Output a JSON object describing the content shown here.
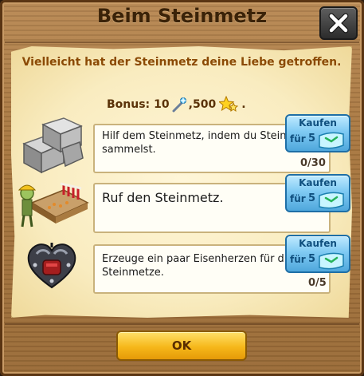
{
  "dialog": {
    "title": "Beim Steinmetz",
    "intro": "Vielleicht hat der Steinmetz deine Liebe getroffen."
  },
  "bonus": {
    "label": "Bonus:",
    "wand_amount": "10",
    "separator": ",",
    "stars_amount": "500",
    "end": ".",
    "icons": [
      "magic-wand-icon",
      "gold-stars-icon"
    ]
  },
  "tasks": [
    {
      "text": "Hilf dem Steinmetz, indem du Steine sammelst.",
      "progress": "0/30",
      "icon": "stone-blocks-icon",
      "buy": {
        "label": "Kaufen",
        "fur": "für",
        "cost": "5",
        "currency_icon": "ticket-icon"
      }
    },
    {
      "text": "Ruf den Steinmetz.",
      "progress": "",
      "icon": "stonemason-workshop-icon",
      "buy": {
        "label": "Kaufen",
        "fur": "für",
        "cost": "5",
        "currency_icon": "ticket-icon"
      }
    },
    {
      "text": "Erzeuge ein paar Eisenherzen für die Steinmetze.",
      "progress": "0/5",
      "icon": "iron-heart-icon",
      "buy": {
        "label": "Kaufen",
        "fur": "für",
        "cost": "5",
        "currency_icon": "ticket-icon"
      }
    }
  ],
  "ok_label": "OK",
  "colors": {
    "wood": "#a8773f",
    "paper": "#f9ecc0",
    "intro_text": "#8b4a05",
    "buy_button": "#7fcaf3",
    "ok_button": "#f6b81a"
  }
}
